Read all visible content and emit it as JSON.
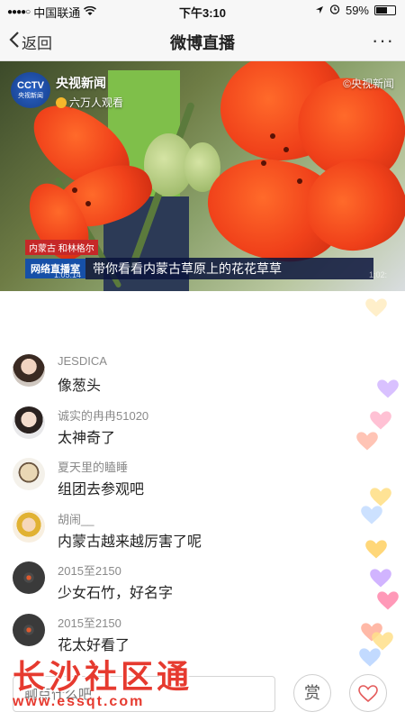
{
  "status_bar": {
    "carrier": "中国联通",
    "time": "下午3:10",
    "battery_percent": "59%",
    "battery_level": 0.59
  },
  "nav": {
    "back_label": "返回",
    "title": "微博直播",
    "more_label": "···"
  },
  "video": {
    "channel_name": "央视新闻",
    "viewer_count": "六万人观看",
    "logo_text": "CCTV",
    "logo_subtext": "央视新闻",
    "watermark": "©央视新闻",
    "location_tag": "内蒙古 和林格尔",
    "caption_label": "网络直播室",
    "caption_text": "带你看看内蒙古草原上的花花草草",
    "time_left": "1:05:14",
    "time_right": "1:02:"
  },
  "comments": [
    {
      "user": "JESDICA",
      "text": "像葱头"
    },
    {
      "user": "诚实的冉冉51020",
      "text": "太神奇了"
    },
    {
      "user": "夏天里的瞌睡",
      "text": "组团去参观吧"
    },
    {
      "user": "胡闹__",
      "text": "内蒙古越来越厉害了呢"
    },
    {
      "user": "2015至2150",
      "text": "少女石竹，好名字"
    },
    {
      "user": "2015至2150",
      "text": "花太好看了"
    }
  ],
  "input": {
    "placeholder": "聊点什么吧"
  },
  "actions": {
    "reward_label": "赏",
    "like_icon": "heart-icon"
  },
  "watermark": {
    "title": "长沙社区通",
    "url": "www.essqt.com"
  },
  "colors": {
    "brand_red": "#e63a2f",
    "heart_colors": [
      "#ffd36b",
      "#c9a7ff",
      "#ff8fb1",
      "#ffb6a3",
      "#ffe08a",
      "#bcd7ff"
    ]
  }
}
